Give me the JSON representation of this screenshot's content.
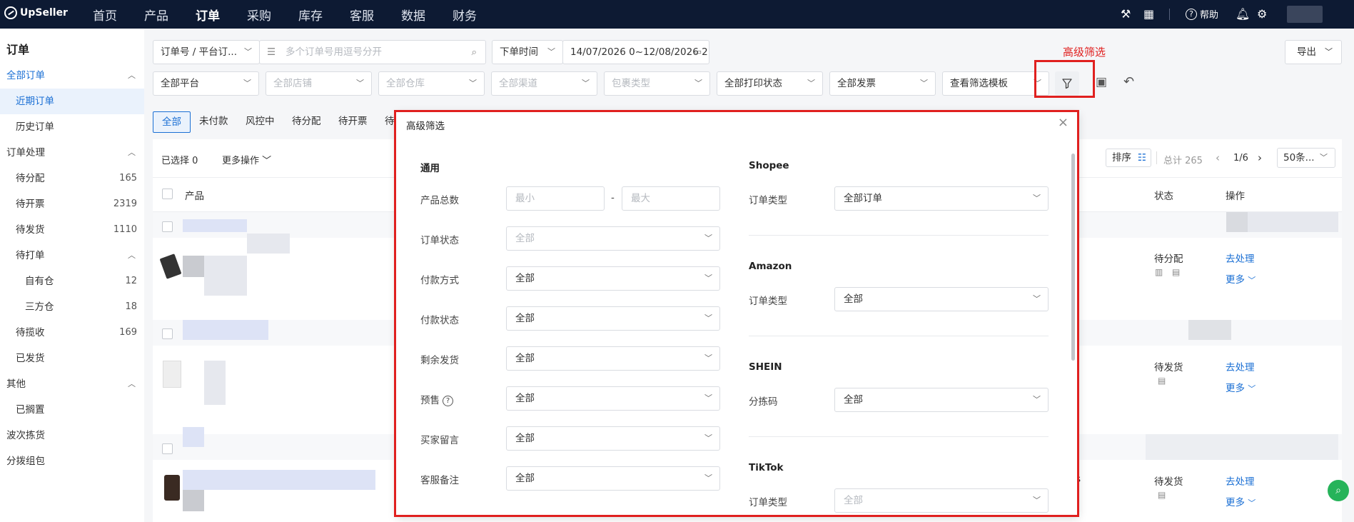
{
  "brand": "UpSeller",
  "nav": [
    "首页",
    "产品",
    "订单",
    "采购",
    "库存",
    "客服",
    "数据",
    "财务"
  ],
  "nav_active": "订单",
  "help_label": "帮助",
  "sidebar": {
    "title": "订单",
    "items": [
      {
        "label": "全部订单",
        "count": "",
        "group": true
      },
      {
        "label": "近期订单",
        "count": ""
      },
      {
        "label": "历史订单",
        "count": ""
      },
      {
        "label": "订单处理",
        "count": "",
        "group": true
      },
      {
        "label": "待分配",
        "count": "165"
      },
      {
        "label": "待开票",
        "count": "2319"
      },
      {
        "label": "待发货",
        "count": "1110"
      },
      {
        "label": "待打单",
        "count": "",
        "group": true
      },
      {
        "label": "自有仓",
        "count": "12"
      },
      {
        "label": "三方仓",
        "count": "18"
      },
      {
        "label": "待揽收",
        "count": "169"
      },
      {
        "label": "已发货",
        "count": ""
      },
      {
        "label": "其他",
        "count": "",
        "group": true
      },
      {
        "label": "已搁置",
        "count": ""
      },
      {
        "label": "波次拣货",
        "count": ""
      },
      {
        "label": "分拨组包",
        "count": ""
      }
    ]
  },
  "filters": {
    "search_type": "订单号 / 平台订...",
    "search_placeholder": "多个订单号用逗号分开",
    "time_type": "下单时间",
    "date_range": "14/07/2026 0~12/08/2026 2",
    "platform": "全部平台",
    "shop": "全部店铺",
    "warehouse": "全部仓库",
    "channel": "全部渠道",
    "package_type": "包裹类型",
    "print_status": "全部打印状态",
    "invoice": "全部发票",
    "template": "查看筛选模板",
    "export": "导出",
    "advanced_label": "高级筛选"
  },
  "tabs": [
    "全部",
    "未付款",
    "风控中",
    "待分配",
    "待开票",
    "待"
  ],
  "toolbar": {
    "selected": "已选择 0",
    "more_ops": "更多操作",
    "sort": "排序",
    "total": "总计 265",
    "page": "1/6",
    "page_size": "50条..."
  },
  "table_headers": {
    "product": "产品",
    "status": "状态",
    "action": "操作"
  },
  "rows": [
    {
      "status": "待分配",
      "action": "去处理",
      "more": "更多"
    },
    {
      "status": "待发货",
      "action": "去处理",
      "more": "更多"
    },
    {
      "status": "待发货",
      "action": "去处理",
      "more": "更多"
    }
  ],
  "row3_fragment": "s",
  "modal": {
    "title": "高级筛选",
    "left_section": "通用",
    "left_fields": [
      {
        "label": "产品总数",
        "min": "最小",
        "max": "最大",
        "sep": "-"
      },
      {
        "label": "订单状态",
        "value": "全部",
        "placeholder": true
      },
      {
        "label": "付款方式",
        "value": "全部"
      },
      {
        "label": "付款状态",
        "value": "全部"
      },
      {
        "label": "剩余发货",
        "value": "全部"
      },
      {
        "label": "预售",
        "value": "全部",
        "help": "?"
      },
      {
        "label": "买家留言",
        "value": "全部"
      },
      {
        "label": "客服备注",
        "value": "全部"
      }
    ],
    "right_sections": [
      {
        "name": "Shopee",
        "label": "订单类型",
        "value": "全部订单"
      },
      {
        "name": "Amazon",
        "label": "订单类型",
        "value": "全部"
      },
      {
        "name": "SHEIN",
        "label": "分拣码",
        "value": "全部"
      },
      {
        "name": "TikTok",
        "label": "订单类型",
        "value": "全部"
      }
    ]
  }
}
